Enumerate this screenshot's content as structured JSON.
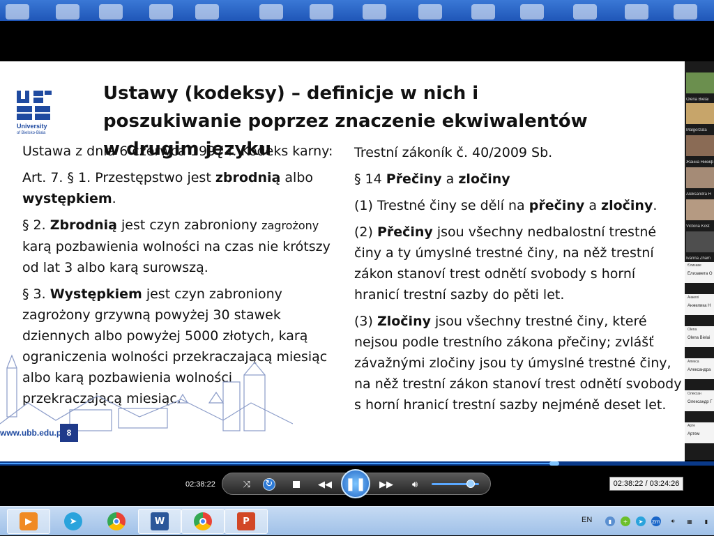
{
  "slide": {
    "title": "Ustawy (kodeksy) – definicje w nich i poszukiwanie poprzez znaczenie ekwiwalentów w drugim języku",
    "logo": {
      "letters": "UBB",
      "name": "University",
      "sub": "of Bielsko-Biala"
    },
    "left": {
      "p1": "Ustawa z dnia 6 czerwca 1997 r. Kodeks karny:",
      "p2_a": "Art. 7. § 1. Przestępstwo jest ",
      "p2_b": "zbrodnią",
      "p2_c": " albo ",
      "p2_d": "występkiem",
      "p2_e": ".",
      "p3_a": "§ 2. ",
      "p3_b": "Zbrodnią",
      "p3_c": " jest czyn zabroniony ",
      "p3_d": "zagrożony",
      "p3_e": " karą pozbawienia wolności na czas nie krótszy od lat 3 albo karą surowszą.",
      "p4_a": "§ 3. ",
      "p4_b": "Występkiem",
      "p4_c": " jest czyn zabroniony zagrożony grzywną powyżej 30 stawek dziennych albo powyżej 5000 złotych, karą ograniczenia wolności przekraczającą miesiąc albo karą pozbawienia wolności przekraczającą miesiąc."
    },
    "right": {
      "p1": "Trestní zákoník č. 40/2009 Sb.",
      "p2_a": "§ 14 ",
      "p2_b": "Přečiny",
      "p2_c": " a ",
      "p2_d": "zločiny",
      "p3_a": "(1) Trestné činy se dělí na ",
      "p3_b": "přečiny",
      "p3_c": " a ",
      "p3_d": "zločiny",
      "p3_e": ".",
      "p4_a": "(2) ",
      "p4_b": "Přečiny",
      "p4_c": " jsou všechny nedbalostní trestné činy a ty úmyslné trestné činy, na něž trestní zákon stanoví trest odnětí svobody s horní hranicí trestní sazby do pěti let.",
      "p5_a": "(3) ",
      "p5_b": "Zločiny",
      "p5_c": " jsou všechny trestné činy, které nejsou podle trestního zákona přečiny; zvlášť závažnými zločiny jsou ty úmyslné trestné činy, na něž trestní zákon stanoví trest odnětí svobody s horní hranicí trestní sazby nejméně deset let."
    },
    "footer_url": "www.ubb.edu.pl",
    "page_number": "8"
  },
  "participants": [
    "Olena Bielai",
    "Malgorzata",
    "Жанна Никиф",
    "Aleksandra H",
    "Victoria Kost",
    "Ivanna Zham",
    "Елизавета О",
    "Анжелика Н",
    "Olena Bielai",
    "Александра",
    "Олександр Г",
    "Артем"
  ],
  "participant_tiles": [
    "Єлизаве",
    "Анжелі",
    "Olena",
    "Алекса",
    "Олексан",
    "Арте"
  ],
  "player": {
    "current_time": "02:38:22",
    "time_display": "02:38:22 / 03:24:26",
    "progress": 0.776,
    "volume": 0.83
  },
  "taskbar": {
    "language": "EN",
    "apps": [
      "media-player",
      "telegram",
      "chrome",
      "word",
      "chrome-profile",
      "presentation"
    ]
  },
  "colors": {
    "brand_blue": "#1f4aa0",
    "accent_blue": "#1e63c4"
  }
}
